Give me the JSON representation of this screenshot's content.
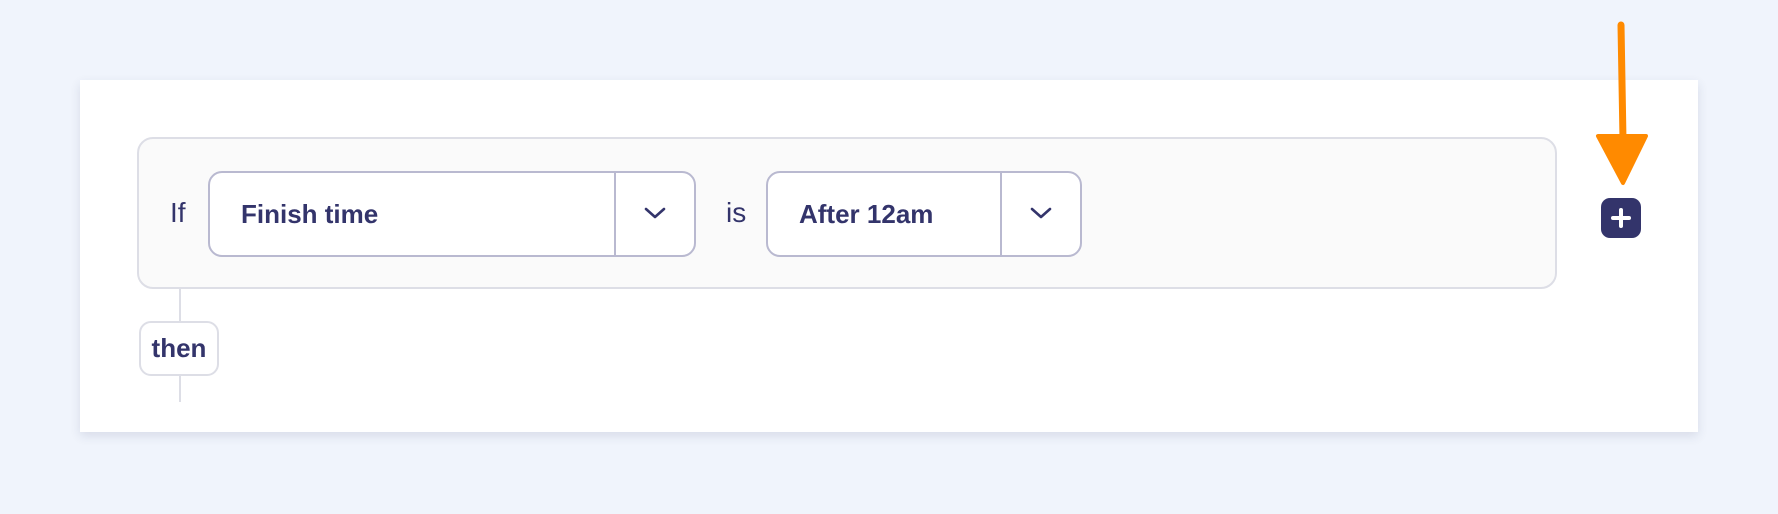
{
  "rule": {
    "if_label": "If",
    "field_select": {
      "value": "Finish time"
    },
    "operator_label": "is",
    "value_select": {
      "value": "After 12am"
    },
    "then_label": "then"
  },
  "icons": {
    "field_chevron": "chevron-down-icon",
    "value_chevron": "chevron-down-icon",
    "add": "plus-icon",
    "pointer": "arrow-down-annotation"
  },
  "colors": {
    "background": "#f0f4fc",
    "text": "#33346b",
    "add_button": "#33346b",
    "annotation_arrow": "#ff8a00"
  }
}
